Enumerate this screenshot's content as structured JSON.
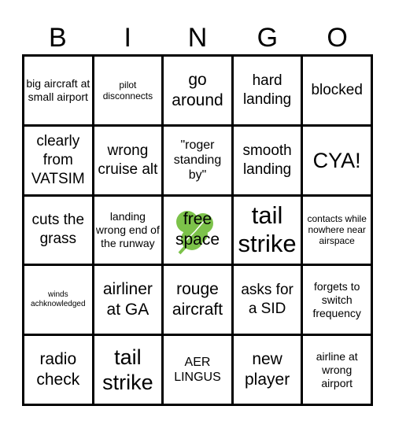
{
  "header": {
    "letters": [
      "B",
      "I",
      "N",
      "G",
      "O"
    ]
  },
  "colors": {
    "clover": "#7cc24a",
    "grid_border": "#000000"
  },
  "free_space_icon": "shamrock-icon",
  "cells": [
    {
      "text": "big aircraft at small airport",
      "size": "s-m"
    },
    {
      "text": "pilot disconnects",
      "size": "s-s"
    },
    {
      "text": "go around",
      "size": "s-xl"
    },
    {
      "text": "hard landing",
      "size": "s-l"
    },
    {
      "text": "blocked",
      "size": "s-l"
    },
    {
      "text": "clearly from VATSIM",
      "size": "s-l"
    },
    {
      "text": "wrong cruise alt",
      "size": "s-l"
    },
    {
      "text": "\"roger standing by\"",
      "size": "s-ml"
    },
    {
      "text": "smooth landing",
      "size": "s-l"
    },
    {
      "text": "CYA!",
      "size": "s-xxl"
    },
    {
      "text": "cuts the grass",
      "size": "s-l"
    },
    {
      "text": "landing wrong end of the runway",
      "size": "s-m"
    },
    {
      "text": "free space",
      "size": "s-xl",
      "free": true
    },
    {
      "text": "tail strike",
      "size": "s-huge"
    },
    {
      "text": "contacts while nowhere near airspace",
      "size": "s-s"
    },
    {
      "text": "winds achknowledged",
      "size": "s-xs"
    },
    {
      "text": "airliner at GA",
      "size": "s-xl"
    },
    {
      "text": "rouge aircraft",
      "size": "s-xl"
    },
    {
      "text": "asks for a SID",
      "size": "s-l"
    },
    {
      "text": "forgets to switch frequency",
      "size": "s-m"
    },
    {
      "text": "radio check",
      "size": "s-xl"
    },
    {
      "text": "tail strike",
      "size": "s-xxl"
    },
    {
      "text": "AER LINGUS",
      "size": "s-ml"
    },
    {
      "text": "new player",
      "size": "s-xl"
    },
    {
      "text": "airline at wrong airport",
      "size": "s-m"
    }
  ]
}
